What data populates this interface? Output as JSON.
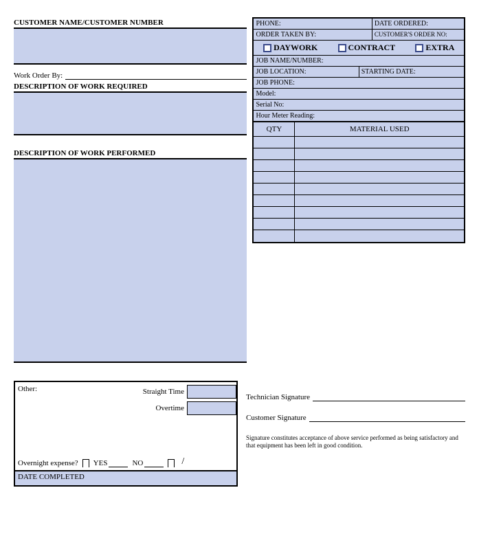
{
  "left": {
    "customer_header": "CUSTOMER NAME/CUSTOMER NUMBER",
    "work_order_by_label": "Work Order By:",
    "work_required_header": "DESCRIPTION OF WORK REQUIRED",
    "work_performed_header": "DESCRIPTION OF WORK PERFORMED"
  },
  "right": {
    "phone": "PHONE:",
    "date_ordered": "DATE ORDERED:",
    "order_taken_by": "ORDER TAKEN BY:",
    "customer_order_no": "CUSTOMER'S ORDER NO:",
    "daywork": "DAYWORK",
    "contract": "CONTRACT",
    "extra": "EXTRA",
    "job_name": "JOB NAME/NUMBER:",
    "job_location": "JOB LOCATION:",
    "starting_date": "STARTING DATE:",
    "job_phone": "JOB PHONE:",
    "model": "Model:",
    "serial": "Serial No:",
    "hour_meter": "Hour Meter Reading:",
    "qty": "QTY",
    "material_used": "MATERIAL USED"
  },
  "bottom": {
    "other": "Other:",
    "straight_time": "Straight Time",
    "overtime": "Overtime",
    "overnight_q": "Overnight expense?",
    "yes": "YES",
    "no": "NO",
    "date_completed": "DATE COMPLETED",
    "tech_sig": "Technician  Signature",
    "cust_sig": "Customer Signature",
    "disclaimer": "Signature constitutes acceptance of above service performed as being satisfactory and that equipment has been left in good condition."
  }
}
